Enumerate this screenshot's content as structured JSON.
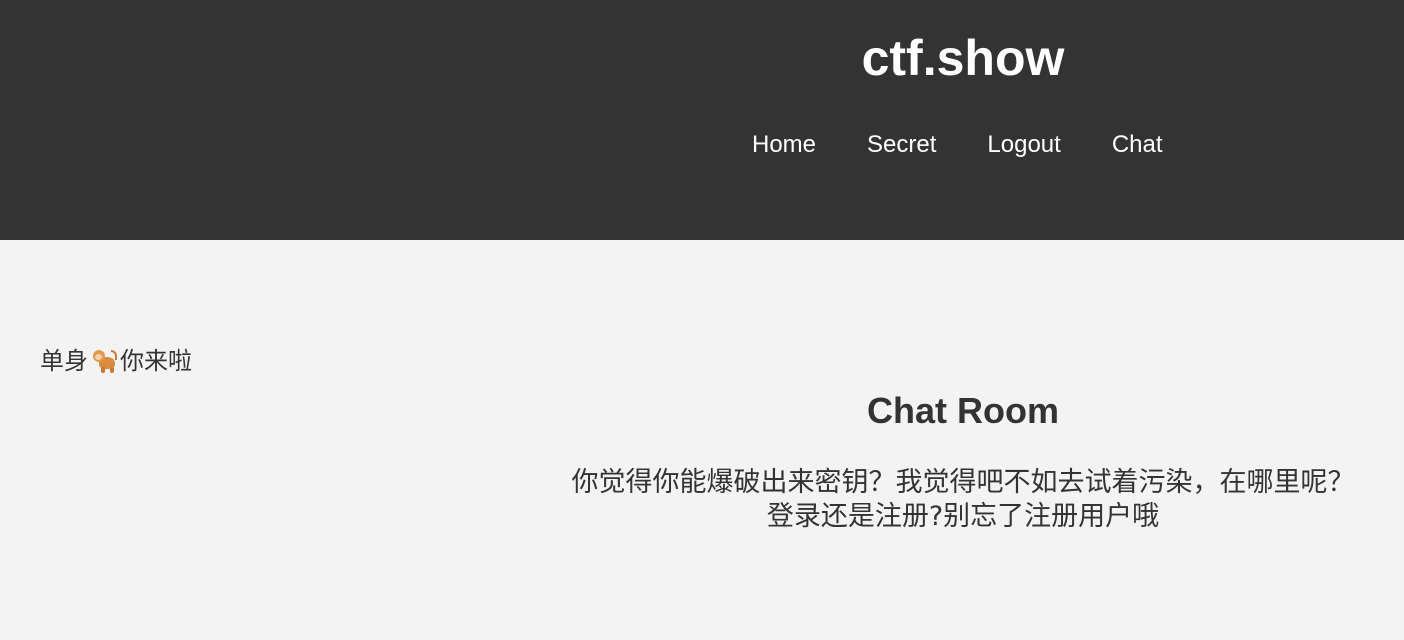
{
  "header": {
    "site_title": "ctf.show",
    "background_color": "#333333",
    "nav": [
      {
        "label": "Home"
      },
      {
        "label": "Secret"
      },
      {
        "label": "Logout"
      },
      {
        "label": "Chat"
      }
    ]
  },
  "aside": {
    "greeting_before": "单身",
    "greeting_icon": "monkey-icon",
    "greeting_after": "你来啦"
  },
  "chat": {
    "title": "Chat Room",
    "message_line1": "你觉得你能爆破出来密钥？我觉得吧不如去试着污染，在哪里呢？",
    "message_line2": "登录还是注册?别忘了注册用户哦"
  },
  "colors": {
    "page_background": "#f3f3f3",
    "text": "#333333",
    "header_text": "#ffffff"
  }
}
